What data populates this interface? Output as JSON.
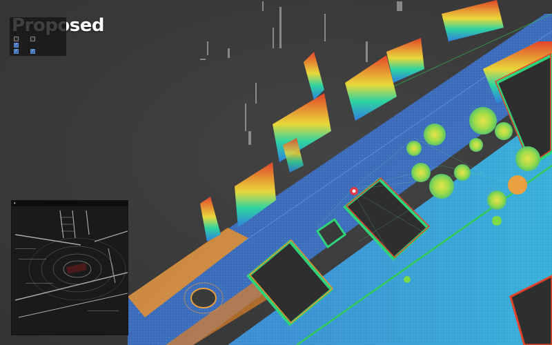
{
  "title": "Proposed",
  "display_panel": {
    "options": [
      {
        "label": "",
        "checked": false
      },
      {
        "label": "",
        "checked": false
      },
      {
        "label": "",
        "checked": true
      },
      {
        "label": "",
        "checked": true
      }
    ]
  },
  "inset": {
    "title": ""
  },
  "colors": {
    "background": "#3b3b3b",
    "road": "#4a6ec7",
    "ground_cyan": "#35a9d9",
    "walls_low": "#2fd37a",
    "walls_mid": "#e8d83a",
    "walls_high": "#e2432a",
    "sidewalk_orange": "#e8902e",
    "trajectory": "#33cc55",
    "vehicle_marker": "#ff3030"
  }
}
